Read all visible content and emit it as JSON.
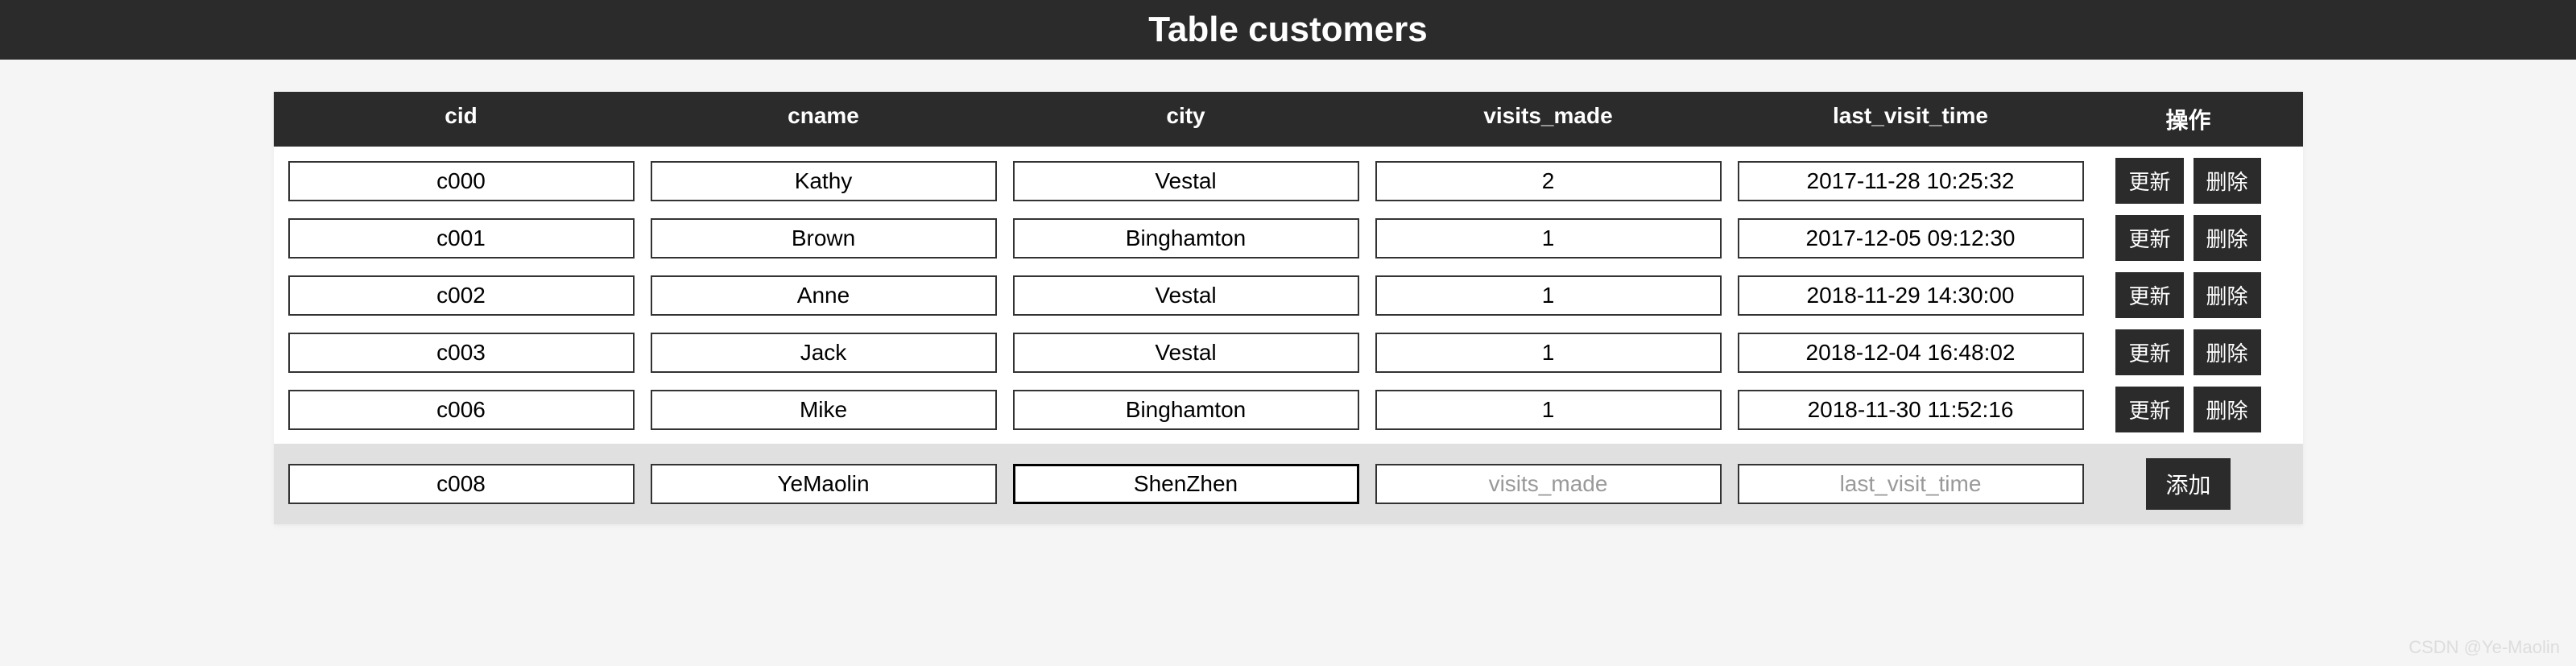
{
  "header": {
    "title": "Table customers"
  },
  "columns": {
    "cid": "cid",
    "cname": "cname",
    "city": "city",
    "visits_made": "visits_made",
    "last_visit_time": "last_visit_time",
    "actions": "操作"
  },
  "rows": [
    {
      "cid": "c000",
      "cname": "Kathy",
      "city": "Vestal",
      "visits_made": "2",
      "last_visit_time": "2017-11-28 10:25:32"
    },
    {
      "cid": "c001",
      "cname": "Brown",
      "city": "Binghamton",
      "visits_made": "1",
      "last_visit_time": "2017-12-05 09:12:30"
    },
    {
      "cid": "c002",
      "cname": "Anne",
      "city": "Vestal",
      "visits_made": "1",
      "last_visit_time": "2018-11-29 14:30:00"
    },
    {
      "cid": "c003",
      "cname": "Jack",
      "city": "Vestal",
      "visits_made": "1",
      "last_visit_time": "2018-12-04 16:48:02"
    },
    {
      "cid": "c006",
      "cname": "Mike",
      "city": "Binghamton",
      "visits_made": "1",
      "last_visit_time": "2018-11-30 11:52:16"
    }
  ],
  "buttons": {
    "update": "更新",
    "delete": "删除",
    "add": "添加"
  },
  "add_row": {
    "cid": "c008",
    "cname": "YeMaolin",
    "city": "ShenZhen",
    "visits_made": "",
    "last_visit_time": "",
    "placeholders": {
      "visits_made": "visits_made",
      "last_visit_time": "last_visit_time"
    }
  },
  "watermark": "CSDN @Ye-Maolin"
}
